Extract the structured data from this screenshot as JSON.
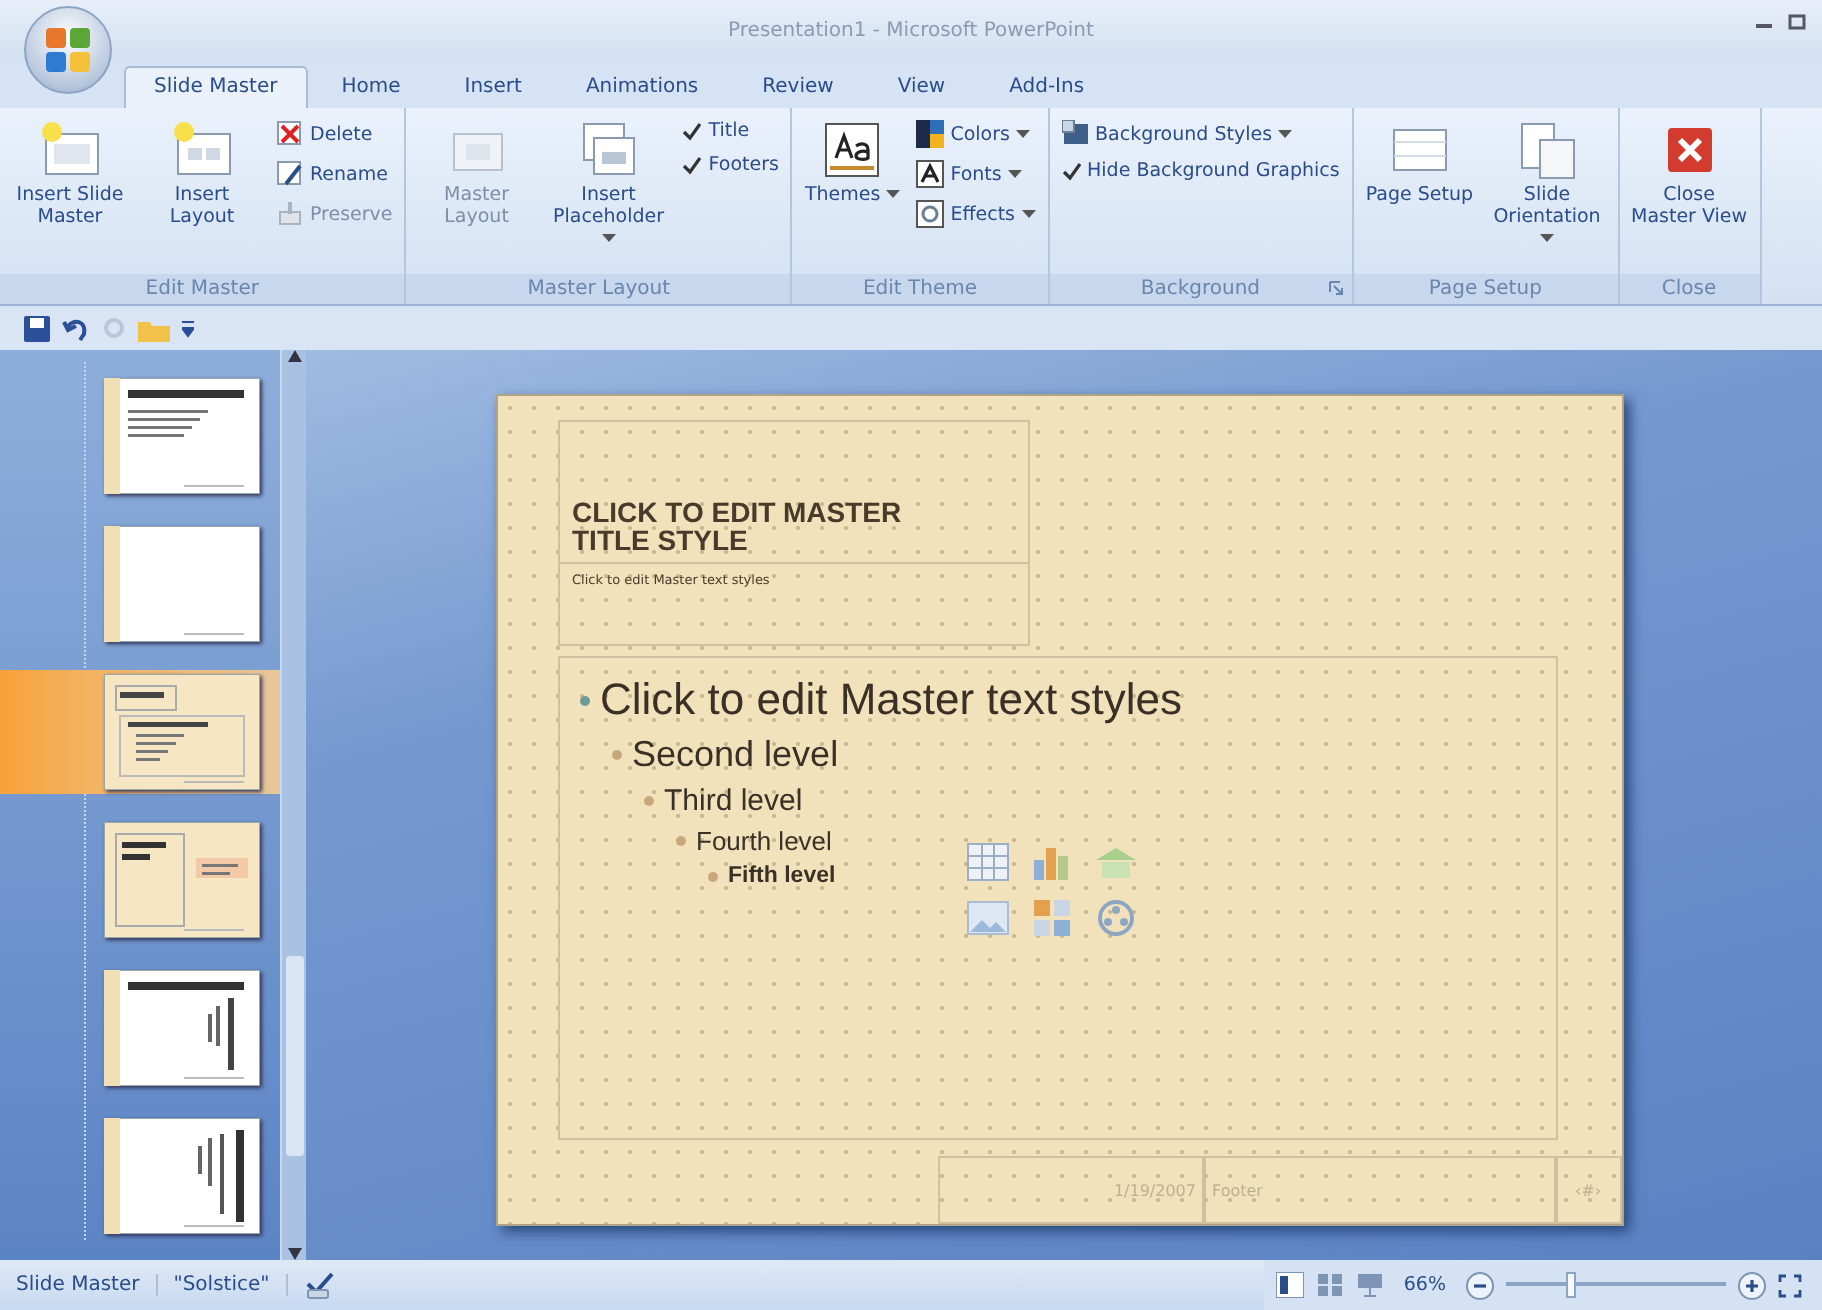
{
  "window": {
    "title": "Presentation1 - Microsoft PowerPoint"
  },
  "tabs": [
    {
      "label": "Slide Master",
      "selected": true
    },
    {
      "label": "Home",
      "selected": false
    },
    {
      "label": "Insert",
      "selected": false
    },
    {
      "label": "Animations",
      "selected": false
    },
    {
      "label": "Review",
      "selected": false
    },
    {
      "label": "View",
      "selected": false
    },
    {
      "label": "Add-Ins",
      "selected": false
    }
  ],
  "ribbon": [
    {
      "label": "Edit Master",
      "items": [
        {
          "kind": "large",
          "label": "Insert Slide Master",
          "disabled": false
        },
        {
          "kind": "large",
          "label": "Insert Layout",
          "disabled": false
        },
        {
          "kind": "small",
          "label": "Delete",
          "disabled": false
        },
        {
          "kind": "small",
          "label": "Rename",
          "disabled": false
        },
        {
          "kind": "small",
          "label": "Preserve",
          "disabled": true
        }
      ]
    },
    {
      "label": "Master Layout",
      "items": [
        {
          "kind": "large",
          "label": "Master Layout",
          "disabled": true
        },
        {
          "kind": "large",
          "label": "Insert Placeholder",
          "disabled": false,
          "dropdown": true
        },
        {
          "kind": "check",
          "label": "Title",
          "checked": true
        },
        {
          "kind": "check",
          "label": "Footers",
          "checked": true
        }
      ]
    },
    {
      "label": "Edit Theme",
      "items": [
        {
          "kind": "large",
          "label": "Themes",
          "disabled": false,
          "dropdown": true
        },
        {
          "kind": "small",
          "label": "Colors",
          "disabled": false,
          "dropdown": true
        },
        {
          "kind": "small",
          "label": "Fonts",
          "disabled": false,
          "dropdown": true
        },
        {
          "kind": "small",
          "label": "Effects",
          "disabled": false,
          "dropdown": true
        }
      ]
    },
    {
      "label": "Background",
      "launcher": true,
      "items": [
        {
          "kind": "small",
          "label": "Background Styles",
          "disabled": false,
          "dropdown": true
        },
        {
          "kind": "check",
          "label": "Hide Background Graphics",
          "checked": true
        }
      ]
    },
    {
      "label": "Page Setup",
      "items": [
        {
          "kind": "large",
          "label": "Page Setup",
          "disabled": false
        },
        {
          "kind": "large",
          "label": "Slide Orientation",
          "disabled": false,
          "dropdown": true
        }
      ]
    },
    {
      "label": "Close",
      "items": [
        {
          "kind": "large",
          "label": "Close Master View",
          "disabled": false
        }
      ]
    }
  ],
  "thumbnails": [
    {
      "kind": "title-content",
      "selected": false
    },
    {
      "kind": "blank",
      "selected": false
    },
    {
      "kind": "title-subtitle",
      "selected": true
    },
    {
      "kind": "two-content",
      "selected": false
    },
    {
      "kind": "vertical-text",
      "selected": false
    },
    {
      "kind": "vertical-title",
      "selected": false
    }
  ],
  "slide": {
    "title": "CLICK TO EDIT MASTER TITLE STYLE",
    "subtitle": "Click to edit Master text styles",
    "body": [
      {
        "text": "Click to edit Master text styles",
        "children": [
          {
            "text": "Second level",
            "children": [
              {
                "text": "Third level",
                "children": [
                  {
                    "text": "Fourth level",
                    "children": [
                      {
                        "text": "Fifth level"
                      }
                    ]
                  }
                ]
              }
            ]
          }
        ]
      }
    ],
    "footer": {
      "date": "1/19/2007",
      "footer": "Footer",
      "number": "‹#›"
    }
  },
  "status_bar": {
    "items": [
      "Slide Master",
      "\"Solstice\""
    ],
    "zoom": "66%",
    "zoom_slider": {
      "level": 0.3
    }
  }
}
